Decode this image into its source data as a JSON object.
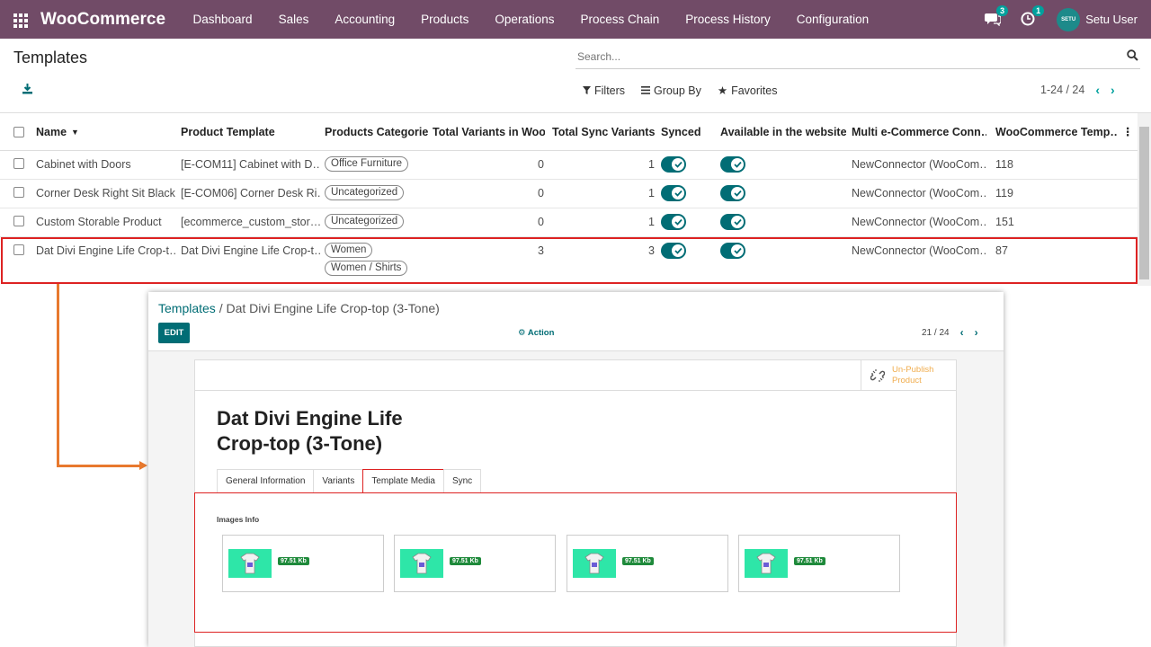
{
  "navbar": {
    "brand": "WooCommerce",
    "menu": [
      "Dashboard",
      "Sales",
      "Accounting",
      "Products",
      "Operations",
      "Process Chain",
      "Process History",
      "Configuration"
    ],
    "messages_count": "3",
    "activities_count": "1",
    "avatar_text": "SETU",
    "user": "Setu User"
  },
  "control": {
    "title": "Templates",
    "search_placeholder": "Search...",
    "filters": "Filters",
    "group_by": "Group By",
    "favorites": "Favorites",
    "pager": "1-24 / 24"
  },
  "table": {
    "columns": [
      "Name",
      "Product Template",
      "Products Categories",
      "Total Variants in Woo",
      "Total Sync Variants",
      "Synced",
      "Available in the website",
      "Multi e-Commerce Conn…",
      "WooCommerce Temp…"
    ],
    "rows": [
      {
        "name": "Cabinet with Doors",
        "template": "[E-COM11] Cabinet with D…",
        "categories": [
          "Office Furniture"
        ],
        "variants": "0",
        "sync": "1",
        "connector": "NewConnector (WooCom…",
        "woo_id": "118"
      },
      {
        "name": "Corner Desk Right Sit Black",
        "template": "[E-COM06] Corner Desk Ri…",
        "categories": [
          "Uncategorized"
        ],
        "variants": "0",
        "sync": "1",
        "connector": "NewConnector (WooCom…",
        "woo_id": "119"
      },
      {
        "name": "Custom Storable Product",
        "template": "[ecommerce_custom_stor…",
        "categories": [
          "Uncategorized"
        ],
        "variants": "0",
        "sync": "1",
        "connector": "NewConnector (WooCom…",
        "woo_id": "151"
      },
      {
        "name": "Dat Divi Engine Life Crop-t…",
        "template": "Dat Divi Engine Life Crop-t…",
        "categories": [
          "Women",
          "Women / Shirts"
        ],
        "variants": "3",
        "sync": "3",
        "connector": "NewConnector (WooCom…",
        "woo_id": "87"
      }
    ]
  },
  "form": {
    "breadcrumb_parent": "Templates",
    "breadcrumb_sep": " / ",
    "breadcrumb_current": "Dat Divi Engine Life Crop-top (3-Tone)",
    "edit": "EDIT",
    "action": "Action",
    "pager": "21 / 24",
    "unpublish": "Un-Publish Product",
    "product_title": "Dat Divi Engine Life Crop-top (3-Tone)",
    "tabs": [
      "General Information",
      "Variants",
      "Template Media",
      "Sync"
    ],
    "active_tab": "Template Media",
    "images_label": "Images Info",
    "images": [
      {
        "size": "97.51 Kb"
      },
      {
        "size": "97.51 Kb"
      },
      {
        "size": "97.51 Kb"
      },
      {
        "size": "97.51 Kb"
      }
    ]
  },
  "colors": {
    "navbar": "#714B67",
    "accent": "#016d75",
    "highlight": "#dd2222",
    "arrow": "#e8792e",
    "unpublish": "#f0ad4e",
    "thumbnail": "#2ee6a8",
    "size_badge": "#1f8a3b"
  }
}
